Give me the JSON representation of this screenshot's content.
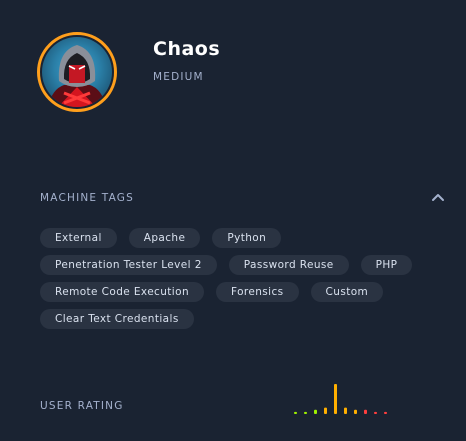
{
  "machine": {
    "name": "Chaos",
    "difficulty": "MEDIUM",
    "avatar_icon": "hooded-ninja-avatar",
    "difficulty_ring_color": "#ff9f1c"
  },
  "tags_section": {
    "label": "MACHINE TAGS",
    "toggle_icon": "chevron-up-icon",
    "rows": [
      [
        "External",
        "Apache",
        "Python"
      ],
      [
        "Penetration Tester Level 2",
        "Password Reuse",
        "PHP"
      ],
      [
        "Remote Code Execution",
        "Forensics",
        "Custom"
      ],
      [
        "Clear Text Credentials"
      ]
    ]
  },
  "rating_section": {
    "label": "USER RATING",
    "chart_data": {
      "type": "bar",
      "values": [
        1,
        1,
        2,
        3,
        14,
        3,
        2,
        2,
        1,
        1
      ],
      "colors": [
        "#9fef00",
        "#9fef00",
        "#9fef00",
        "#ffaf00",
        "#ffaf00",
        "#ffaf00",
        "#ffaf00",
        "#ff3e3e",
        "#ff3e3e",
        "#ff3e3e"
      ]
    }
  }
}
